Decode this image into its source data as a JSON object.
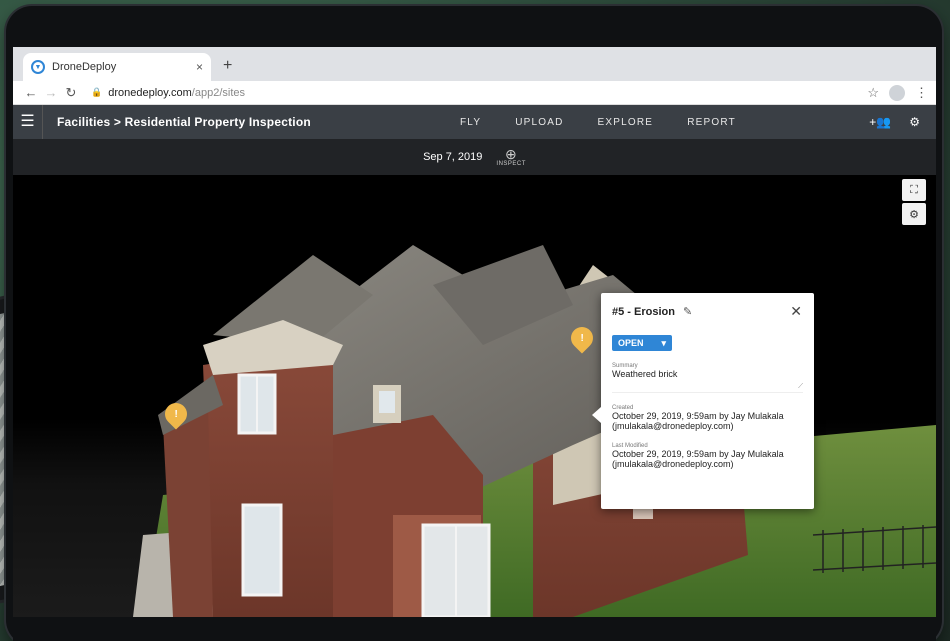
{
  "browser": {
    "tab_title": "DroneDeploy",
    "tab_close": "×",
    "new_tab": "+",
    "url_host": "dronedeploy.com",
    "url_path": "/app2/sites"
  },
  "app": {
    "breadcrumb": "Facilities > Residential Property Inspection",
    "nav": [
      "FLY",
      "UPLOAD",
      "EXPLORE",
      "REPORT"
    ],
    "date": "Sep 7, 2019",
    "inspect_label": "INSPECT"
  },
  "issue": {
    "title": "#5 - Erosion",
    "status": "OPEN",
    "summary_label": "Summary",
    "summary": "Weathered brick",
    "created_label": "Created",
    "created_value": "October 29, 2019, 9:59am by Jay Mulakala (jmulakala@dronedeploy.com)",
    "modified_label": "Last Modified",
    "modified_value": "October 29, 2019, 9:59am by Jay Mulakala (jmulakala@dronedeploy.com)"
  },
  "colors": {
    "accent": "#2f86d6",
    "marker": "#f0b84a",
    "header": "#3a3f45"
  }
}
